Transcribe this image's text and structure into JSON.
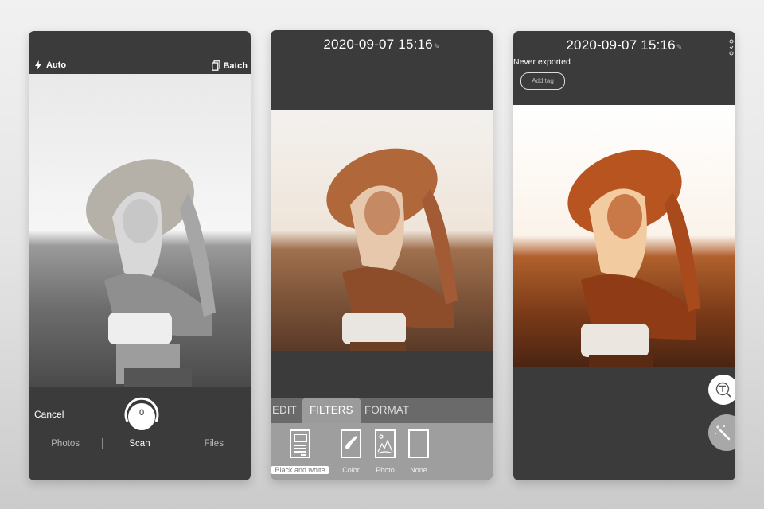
{
  "screens": {
    "scan": {
      "flash_label": "Auto",
      "batch_label": "Batch",
      "cancel_label": "Cancel",
      "shutter_count": "0",
      "modes": [
        {
          "label": "Photos",
          "active": false
        },
        {
          "label": "Scan",
          "active": true
        },
        {
          "label": "Files",
          "active": false
        }
      ],
      "photo": {
        "subject": "woman in straw hat",
        "filter": "black and white"
      }
    },
    "filters": {
      "title": "2020-09-07 15:16",
      "tabs": [
        {
          "label": "EDIT",
          "active": false
        },
        {
          "label": "FILTERS",
          "active": true
        },
        {
          "label": "FORMAT",
          "active": false
        }
      ],
      "filter_options": [
        {
          "label": "Black and white",
          "icon": "document-icon",
          "selected": true
        },
        {
          "label": "Color",
          "icon": "brush-icon",
          "selected": false
        },
        {
          "label": "Photo",
          "icon": "image-icon",
          "selected": false
        },
        {
          "label": "None",
          "icon": "blank-page-icon",
          "selected": false
        }
      ],
      "photo": {
        "subject": "woman in straw hat",
        "filter": "warm color"
      }
    },
    "detail": {
      "title": "2020-09-07 15:16",
      "export_status": "Never exported",
      "add_tag_label": "Add tag",
      "fab_icons": [
        "text-recognition-icon",
        "magic-wand-icon"
      ],
      "photo": {
        "subject": "woman in straw hat",
        "filter": "color"
      }
    }
  },
  "colors": {
    "phone_bg": "#3b3b3b",
    "tabbar_bg": "#6a6a6a",
    "filters_bg": "#9e9e9e",
    "active_tab_bg": "#9b9b9b"
  }
}
